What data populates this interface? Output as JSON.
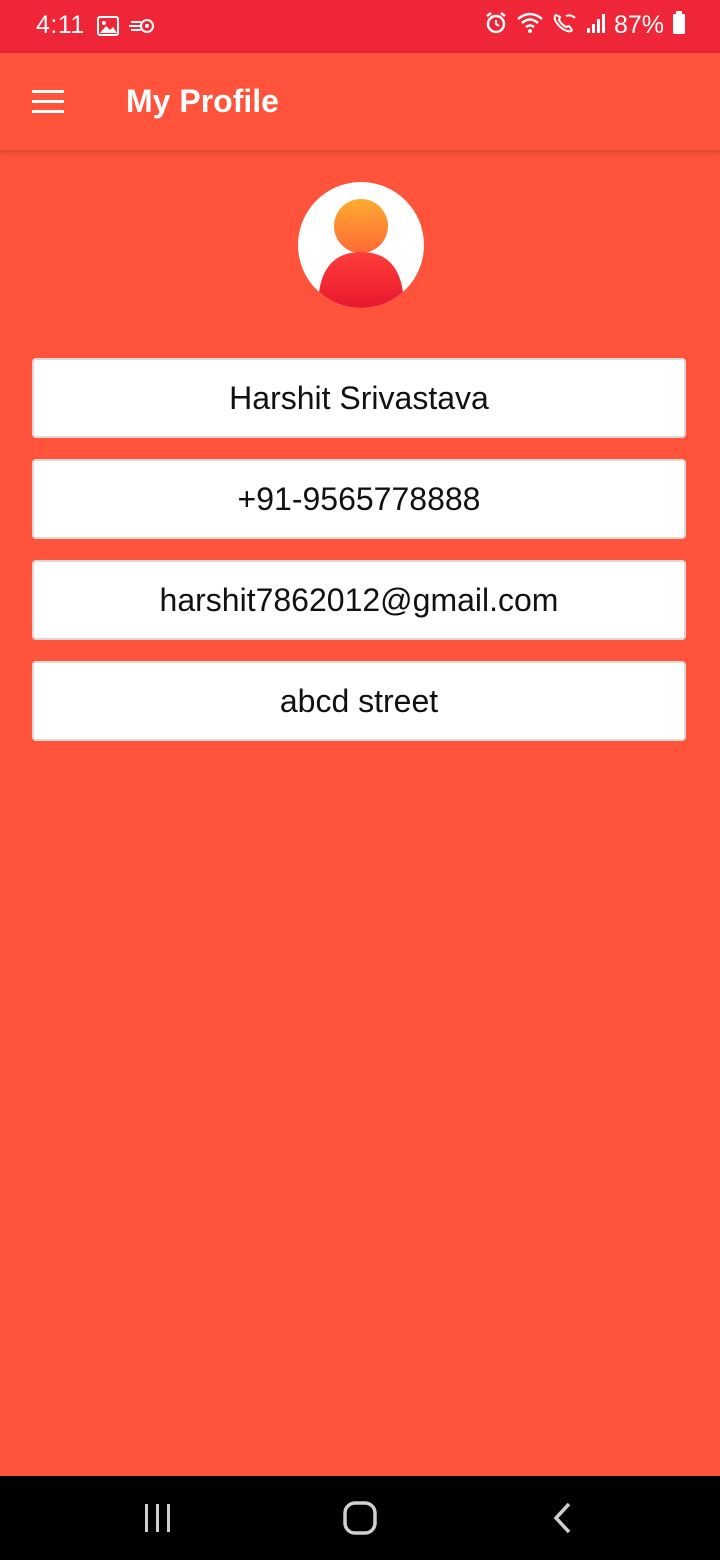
{
  "status_bar": {
    "time": "4:11",
    "battery": "87%",
    "icons": [
      "image-icon",
      "cast-icon",
      "alarm-icon",
      "wifi-icon",
      "wifi-calling-icon",
      "signal-icon",
      "battery-icon"
    ]
  },
  "app_bar": {
    "title": "My Profile",
    "menu_icon": "hamburger-menu-icon"
  },
  "profile": {
    "avatar_icon": "user-avatar-icon",
    "name": "Harshit Srivastava",
    "phone": "+91-9565778888",
    "email": "harshit7862012@gmail.com",
    "address": "abcd street"
  },
  "nav_bar": {
    "icons": [
      "recent-apps-icon",
      "home-icon",
      "back-icon"
    ]
  },
  "colors": {
    "status_bar": "#ef2637",
    "primary": "#ff533b",
    "field_bg": "#ffffff",
    "nav_bar": "#000000"
  }
}
